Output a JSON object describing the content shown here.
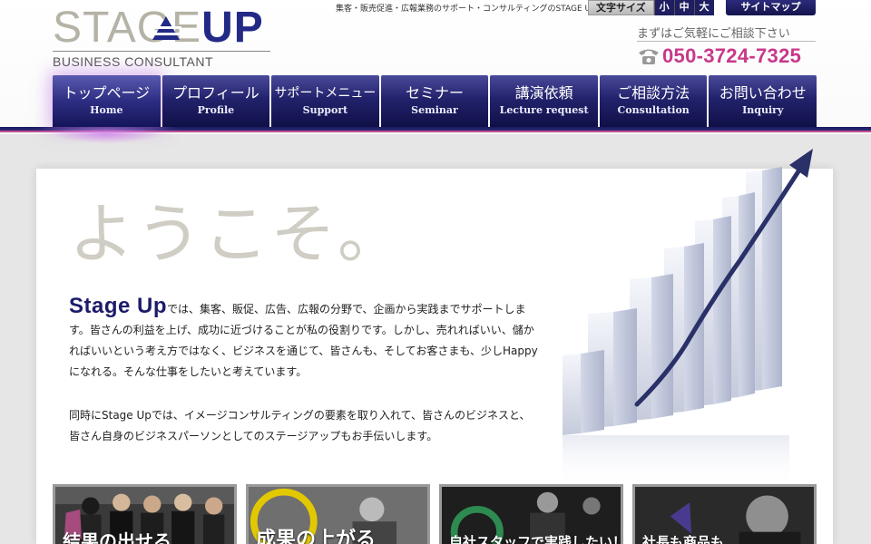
{
  "header": {
    "logo_word": "STAGE",
    "logo_up": "UP",
    "logo_sub": "BUSINESS CONSULTANT",
    "tagline": "集客・販売促進・広報業務のサポート・コンサルティングのSTAGE UP",
    "font_size_label": "文字サイズ",
    "font_sizes": [
      "小",
      "中",
      "大"
    ],
    "sitemap_label": "サイトマップ",
    "contact_note": "まずはご気軽にご相談下さい",
    "phone": "050-3724-7325"
  },
  "nav": {
    "items": [
      {
        "jp": "トップページ",
        "en": "Home"
      },
      {
        "jp": "プロフィール",
        "en": "Profile"
      },
      {
        "jp": "サポートメニュー",
        "en": "Support"
      },
      {
        "jp": "セミナー",
        "en": "Seminar"
      },
      {
        "jp": "講演依頼",
        "en": "Lecture request"
      },
      {
        "jp": "ご相談方法",
        "en": "Consultation"
      },
      {
        "jp": "お問い合わせ",
        "en": "Inquiry"
      }
    ]
  },
  "main": {
    "welcome": "ようこそ。",
    "brand": "Stage Up",
    "intro_rest": "では、集客、販促、広告、広報の分野で、企画から実践までサポートします。皆さんの利益を上げ、成功に近づけることが私の役割りです。しかし、売れればいい、儲かればいいという考え方ではなく、ビジネスを通じて、皆さんも、そしてお客さまも、少しHappyになれる。そんな仕事をしたいと考えています。",
    "intro2": "同時にStage Upでは、イメージコンサルティングの要素を取り入れて、皆さんのビジネスと、皆さん自身のビジネスパーソンとしてのステージアップもお手伝いします。"
  },
  "cards": [
    {
      "caption": "結果の出せる"
    },
    {
      "caption": "成果の上がる"
    },
    {
      "caption": "自社スタッフで実践したい！"
    },
    {
      "caption": "社長も商品も"
    }
  ],
  "colors": {
    "brand_navy": "#232a86",
    "phone_pink": "#c8388a",
    "logo_gray": "#b5b2a6"
  }
}
